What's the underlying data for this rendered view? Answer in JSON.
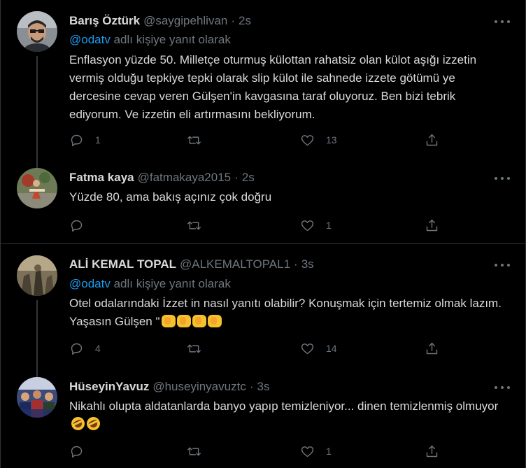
{
  "tweets": [
    {
      "name": "Barış Öztürk",
      "handle": "@saygipehlivan",
      "time": "2s",
      "reply_prefix": "@odatv",
      "reply_suffix": "adlı kişiye yanıt olarak",
      "text": "Enflasyon yüzde 50. Milletçe oturmuş külottan rahatsiz olan külot aşığı izzetin vermiş olduğu tepkiye tepki olarak slip külot ile sahnede izzete götümü ye dercesine cevap veren Gülşen'in kavgasına taraf oluyoruz. Ben bizi tebrik ediyorum. Ve izzetin eli artırmasını bekliyorum.",
      "reply_count": "1",
      "retweet_count": "",
      "like_count": "13"
    },
    {
      "name": "Fatma kaya",
      "handle": "@fatmakaya2015",
      "time": "2s",
      "text": "Yüzde 80, ama  bakış açınız çok doğru",
      "reply_count": "",
      "retweet_count": "",
      "like_count": "1"
    },
    {
      "name": "ALİ KEMAL TOPAL",
      "handle": "@ALKEMALTOPAL1",
      "time": "3s",
      "reply_prefix": "@odatv",
      "reply_suffix": "adlı kişiye yanıt olarak",
      "text": "Otel odalarındaki İzzet in nasıl yanıtı olabilir? Konuşmak için tertemiz olmak lazım. Yaşasın Gülşen \"",
      "emoji": "clapping-hands",
      "reply_count": "4",
      "retweet_count": "",
      "like_count": "14"
    },
    {
      "name": "HüseyinYavuz",
      "handle": "@huseyinyavuztc",
      "time": "3s",
      "text": "Nikahlı olupta aldatanlarda banyo yapıp temizleniyor... dinen temizlenmiş olmuyor",
      "emoji": "rolling-on-floor-laughing",
      "reply_count": "",
      "retweet_count": "",
      "like_count": "1"
    }
  ],
  "colors": {
    "background": "#000000",
    "text": "#d9d9d9",
    "secondary": "#6e767d",
    "link": "#1d9bf0",
    "divider": "#2f3336"
  },
  "icons": [
    "reply-icon",
    "retweet-icon",
    "like-icon",
    "share-icon",
    "more-icon"
  ]
}
